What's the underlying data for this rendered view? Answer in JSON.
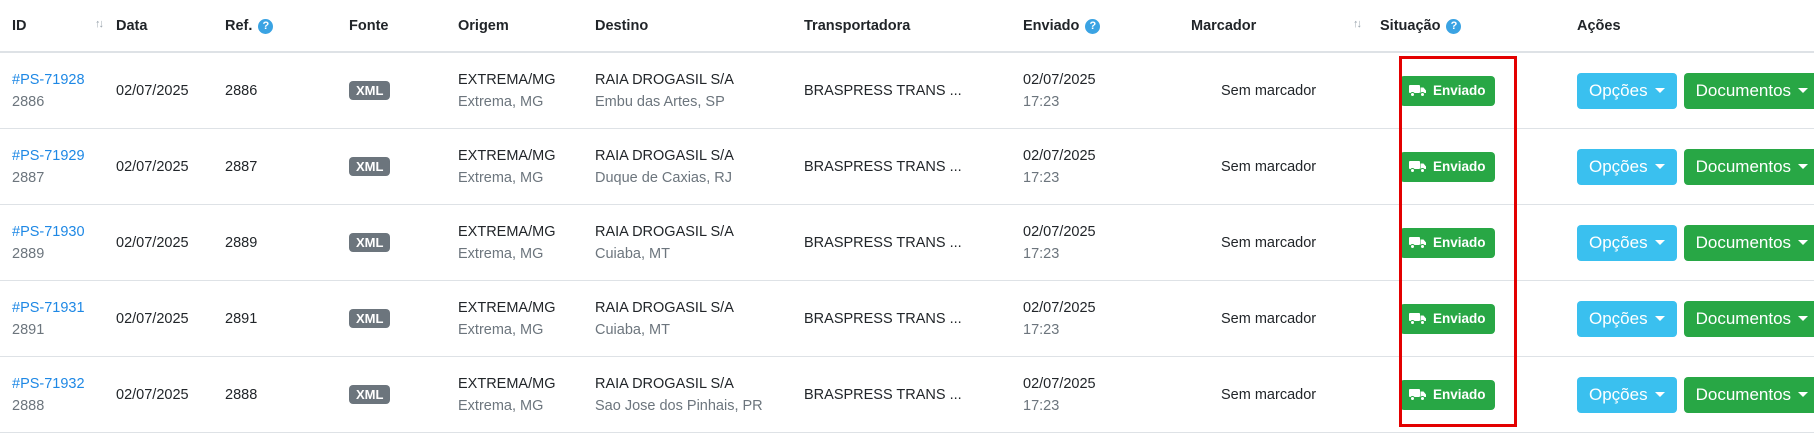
{
  "headers": {
    "id": "ID",
    "data": "Data",
    "ref": "Ref.",
    "fonte": "Fonte",
    "origem": "Origem",
    "destino": "Destino",
    "transportadora": "Transportadora",
    "enviado": "Enviado",
    "marcador": "Marcador",
    "situacao": "Situação",
    "acoes": "Ações"
  },
  "help_glyph": "?",
  "sort_glyph": "↑↓",
  "buttons": {
    "opcoes": "Opções",
    "documentos": "Documentos"
  },
  "colors": {
    "link": "#1e88e5",
    "status_green": "#28a745",
    "info_blue": "#3ac0ef",
    "badge_gray": "#6c757d",
    "highlight_red": "#e30000"
  },
  "rows": [
    {
      "id": "#PS-71928",
      "sub_id": "2886",
      "data": "02/07/2025",
      "ref": "2886",
      "fonte": "XML",
      "origem": "EXTREMA/MG",
      "origem_cidade": "Extrema, MG",
      "destino": "RAIA DROGASIL S/A",
      "destino_cidade": "Embu das Artes, SP",
      "transportadora": "BRASPRESS TRANS ...",
      "enviado_data": "02/07/2025",
      "enviado_hora": "17:23",
      "marcador": "Sem marcador",
      "situacao": "Enviado"
    },
    {
      "id": "#PS-71929",
      "sub_id": "2887",
      "data": "02/07/2025",
      "ref": "2887",
      "fonte": "XML",
      "origem": "EXTREMA/MG",
      "origem_cidade": "Extrema, MG",
      "destino": "RAIA DROGASIL S/A",
      "destino_cidade": "Duque de Caxias, RJ",
      "transportadora": "BRASPRESS TRANS ...",
      "enviado_data": "02/07/2025",
      "enviado_hora": "17:23",
      "marcador": "Sem marcador",
      "situacao": "Enviado"
    },
    {
      "id": "#PS-71930",
      "sub_id": "2889",
      "data": "02/07/2025",
      "ref": "2889",
      "fonte": "XML",
      "origem": "EXTREMA/MG",
      "origem_cidade": "Extrema, MG",
      "destino": "RAIA DROGASIL S/A",
      "destino_cidade": "Cuiaba, MT",
      "transportadora": "BRASPRESS TRANS ...",
      "enviado_data": "02/07/2025",
      "enviado_hora": "17:23",
      "marcador": "Sem marcador",
      "situacao": "Enviado"
    },
    {
      "id": "#PS-71931",
      "sub_id": "2891",
      "data": "02/07/2025",
      "ref": "2891",
      "fonte": "XML",
      "origem": "EXTREMA/MG",
      "origem_cidade": "Extrema, MG",
      "destino": "RAIA DROGASIL S/A",
      "destino_cidade": "Cuiaba, MT",
      "transportadora": "BRASPRESS TRANS ...",
      "enviado_data": "02/07/2025",
      "enviado_hora": "17:23",
      "marcador": "Sem marcador",
      "situacao": "Enviado"
    },
    {
      "id": "#PS-71932",
      "sub_id": "2888",
      "data": "02/07/2025",
      "ref": "2888",
      "fonte": "XML",
      "origem": "EXTREMA/MG",
      "origem_cidade": "Extrema, MG",
      "destino": "RAIA DROGASIL S/A",
      "destino_cidade": "Sao Jose dos Pinhais, PR",
      "transportadora": "BRASPRESS TRANS ...",
      "enviado_data": "02/07/2025",
      "enviado_hora": "17:23",
      "marcador": "Sem marcador",
      "situacao": "Enviado"
    }
  ]
}
